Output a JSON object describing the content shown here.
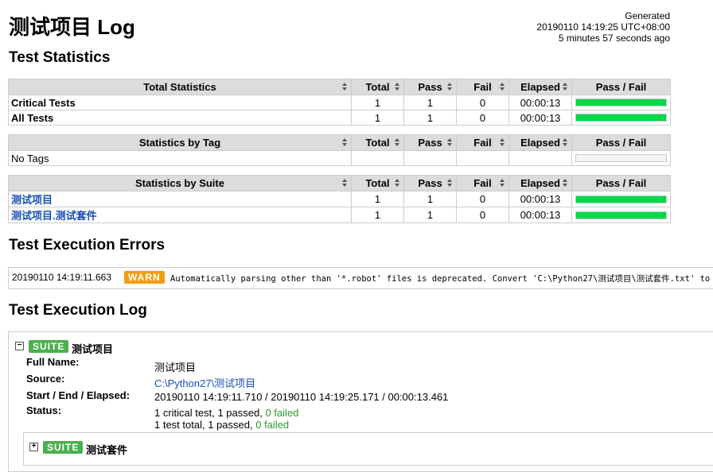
{
  "page": {
    "title": "测试项目 Log",
    "generated_label": "Generated",
    "generated_time": "20190110 14:19:25 UTC+08:00",
    "generated_ago": "5 minutes 57 seconds ago"
  },
  "colors": {
    "pass_bar": "#00d94a",
    "warn": "#f39c12",
    "suite": "#4caf50",
    "link": "#1a4fb8"
  },
  "sections": {
    "statistics": "Test Statistics",
    "errors": "Test Execution Errors",
    "log": "Test Execution Log"
  },
  "columns": {
    "total": "Total",
    "pass": "Pass",
    "fail": "Fail",
    "elapsed": "Elapsed",
    "pass_fail": "Pass / Fail"
  },
  "total_stats": {
    "header": "Total Statistics",
    "rows": [
      {
        "name": "Critical Tests",
        "total": "1",
        "pass": "1",
        "fail": "0",
        "elapsed": "00:00:13",
        "pass_ratio": 1.0
      },
      {
        "name": "All Tests",
        "total": "1",
        "pass": "1",
        "fail": "0",
        "elapsed": "00:00:13",
        "pass_ratio": 1.0
      }
    ]
  },
  "tag_stats": {
    "header": "Statistics by Tag",
    "rows": [
      {
        "name": "No Tags",
        "pass_ratio": 0
      }
    ]
  },
  "suite_stats": {
    "header": "Statistics by Suite",
    "rows": [
      {
        "name": "测试项目",
        "total": "1",
        "pass": "1",
        "fail": "0",
        "elapsed": "00:00:13",
        "pass_ratio": 1.0
      },
      {
        "name": "测试项目.测试套件",
        "total": "1",
        "pass": "1",
        "fail": "0",
        "elapsed": "00:00:13",
        "pass_ratio": 1.0
      }
    ]
  },
  "errors": [
    {
      "timestamp": "20190110 14:19:11.663",
      "level": "WARN",
      "message": "Automatically parsing other than '*.robot' files is deprecated. Convert 'C:\\Python27\\测试项目\\测试套件.txt' to"
    }
  ],
  "log": {
    "suite": {
      "toggle": "−",
      "badge": "SUITE",
      "name": "测试项目",
      "full_name_label": "Full Name:",
      "full_name": "测试项目",
      "source_label": "Source:",
      "source": "C:\\Python27\\测试项目",
      "times_label": "Start / End / Elapsed:",
      "times": "20190110 14:19:11.710 / 20190110 14:19:25.171 / 00:00:13.461",
      "status_label": "Status:",
      "status_line1_prefix": "1 critical test, 1 passed, ",
      "status_line1_failed": "0 failed",
      "status_line2_prefix": "1 test total, 1 passed, ",
      "status_line2_failed": "0 failed"
    },
    "child": {
      "toggle": "+",
      "badge": "SUITE",
      "name": "测试套件"
    }
  }
}
